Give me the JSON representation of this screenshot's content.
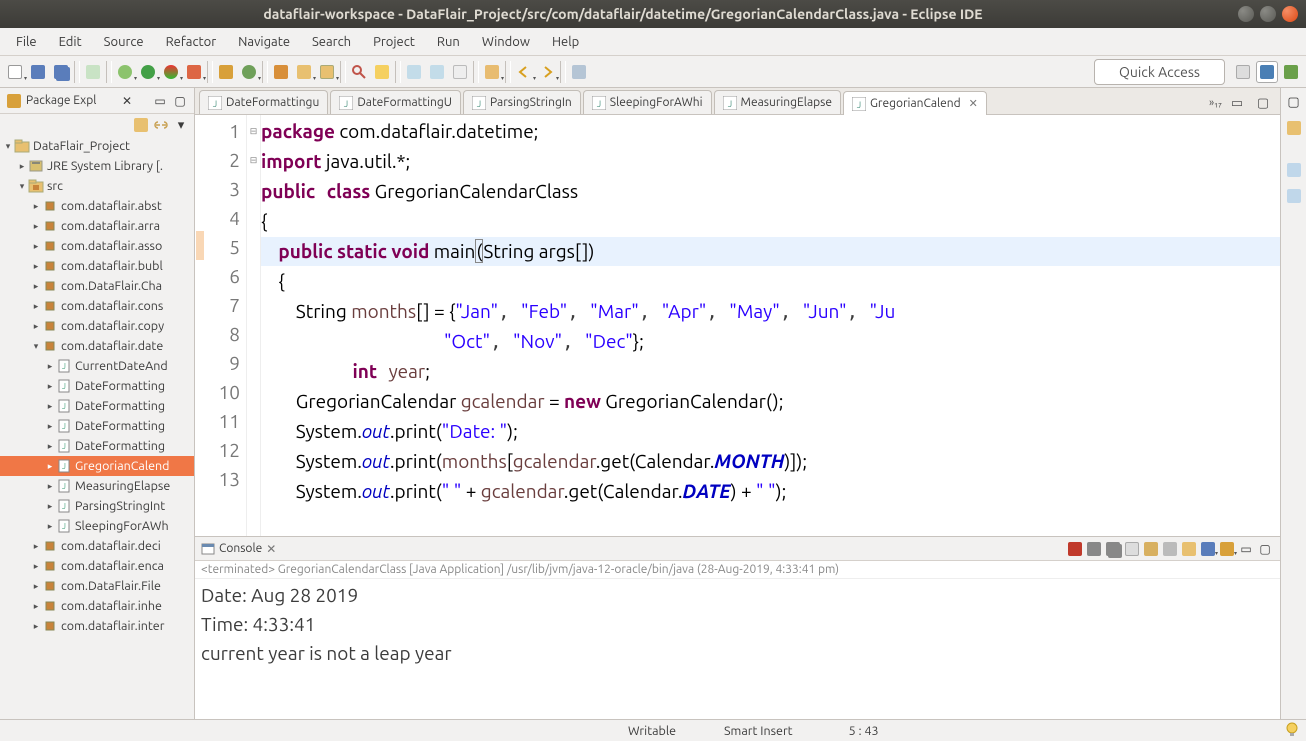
{
  "titlebar": {
    "text": "dataflair-workspace - DataFlair_Project/src/com/dataflair/datetime/GregorianCalendarClass.java - Eclipse IDE"
  },
  "menu": [
    "File",
    "Edit",
    "Source",
    "Refactor",
    "Navigate",
    "Search",
    "Project",
    "Run",
    "Window",
    "Help"
  ],
  "quick_access": "Quick Access",
  "package_explorer": {
    "title": "Package Expl",
    "project": "DataFlair_Project",
    "jre": "JRE System Library [.",
    "src": "src",
    "packages_top": [
      "com.dataflair.abst",
      "com.dataflair.arra",
      "com.dataflair.asso",
      "com.dataflair.bubl",
      "com.DataFlair.Cha",
      "com.dataflair.cons",
      "com.dataflair.copy"
    ],
    "package_open": "com.dataflair.date",
    "files": [
      "CurrentDateAnd",
      "DateFormatting",
      "DateFormatting",
      "DateFormatting",
      "DateFormatting",
      "GregorianCalend",
      "MeasuringElapse",
      "ParsingStringInt",
      "SleepingForAWh"
    ],
    "packages_bottom": [
      "com.dataflair.deci",
      "com.dataflair.enca",
      "com.DataFlair.File",
      "com.dataflair.inhe",
      "com.dataflair.inter"
    ]
  },
  "editor": {
    "tabs": [
      "DateFormattingu",
      "DateFormattingU",
      "ParsingStringIn",
      "SleepingForAWhi",
      "MeasuringElapse",
      "GregorianCalend"
    ],
    "active_tab": 5,
    "overflow": "»₁₇"
  },
  "code_tokens": {
    "l1a": "package",
    "l1b": " com.dataflair.datetime;",
    "l2a": "import",
    "l2b": " java.util.*;",
    "l3a": "public",
    "l3b": "class",
    "l3c": " GregorianCalendarClass",
    "l4": "{",
    "l5a": "public",
    "l5b": "static",
    "l5c": "void",
    "l5d": " main",
    "l5e": "(",
    "l5f": "String args[])",
    "l6": "    {",
    "l7a": "        String ",
    "l7b": "months",
    "l7c": "[] = {",
    "l7s1": "\"Jan\"",
    "l7s2": "\"Feb\"",
    "l7s3": "\"Mar\"",
    "l7s4": "\"Apr\"",
    "l7s5": "\"May\"",
    "l7s6": "\"Jun\"",
    "l7s7": "\"Ju",
    "l8s1": "\"Oct\"",
    "l8s2": "\"Nov\"",
    "l8s3": "\"Dec\"",
    "l8e": "};",
    "l9a": "int",
    "l9b": "year",
    "l9c": ";",
    "l10a": "        GregorianCalendar ",
    "l10b": "gcalendar",
    "l10c": " = ",
    "l10d": "new",
    "l10e": " GregorianCalendar();",
    "l11a": "        System.",
    "l11b": "out",
    "l11c": ".print(",
    "l11d": "\"Date: \"",
    "l11e": ");",
    "l12a": "        System.",
    "l12b": "out",
    "l12c": ".print(",
    "l12d": "months",
    "l12e": "[",
    "l12f": "gcalendar",
    "l12g": ".get(Calendar.",
    "l12h": "MONTH",
    "l12i": ")]);",
    "l13a": "        System.",
    "l13b": "out",
    "l13c": ".print(",
    "l13d": "\" \"",
    "l13e": " + ",
    "l13f": "gcalendar",
    "l13g": ".get(Calendar.",
    "l13h": "DATE",
    "l13i": ") + ",
    "l13j": "\" \"",
    "l13k": ");"
  },
  "console": {
    "title": "Console",
    "info": "<terminated> GregorianCalendarClass [Java Application] /usr/lib/jvm/java-12-oracle/bin/java (28-Aug-2019, 4:33:41 pm)",
    "lines": [
      "Date: Aug 28 2019",
      "Time: 4:33:41",
      "current year is not a leap year"
    ]
  },
  "status": {
    "writable": "Writable",
    "insert": "Smart Insert",
    "pos": "5 : 43"
  }
}
